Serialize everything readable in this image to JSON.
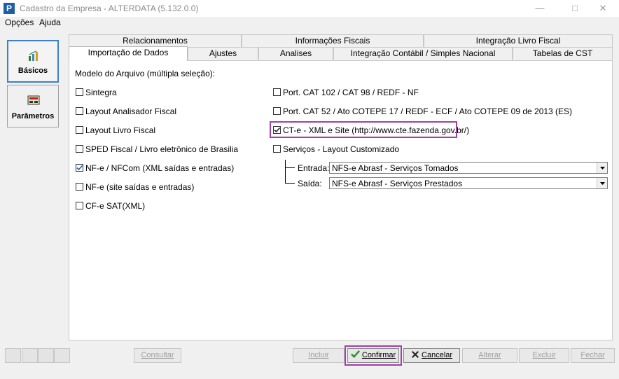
{
  "window": {
    "title": "Cadastro da Empresa - ALTERDATA (5.132.0.0)",
    "app_icon": "P"
  },
  "menu": [
    "Opções",
    "Ajuda"
  ],
  "sidebar": {
    "items": [
      {
        "label": "Básicos",
        "icon": "basicos-icon",
        "selected": true
      },
      {
        "label": "Parâmetros",
        "icon": "parametros-icon",
        "selected": false
      }
    ]
  },
  "tabs": {
    "row1": [
      "Relacionamentos",
      "Informações Fiscais",
      "Integração Livro Fiscal"
    ],
    "row2": [
      "Importação de Dados",
      "Ajustes",
      "Analises",
      "Integração Contábil / Simples Nacional",
      "Tabelas de CST"
    ],
    "active": "Importação de Dados"
  },
  "content": {
    "group_label": "Modelo do Arquivo (múltipla seleção):",
    "left_options": [
      {
        "label": "Sintegra",
        "checked": false
      },
      {
        "label": "Layout Analisador Fiscal",
        "checked": false
      },
      {
        "label": "Layout Livro Fiscal",
        "checked": false
      },
      {
        "label": "SPED Fiscal / Livro eletrônico de Brasilia",
        "checked": false
      },
      {
        "label": "NF-e / NFCom (XML saídas e entradas)",
        "checked": true
      },
      {
        "label": "NF-e (site saídas e entradas)",
        "checked": false
      },
      {
        "label": "CF-e SAT(XML)",
        "checked": false
      }
    ],
    "right_options": [
      {
        "label": "Port. CAT 102 / CAT 98 / REDF - NF",
        "checked": false
      },
      {
        "label": "Port. CAT 52 / Ato COTEPE 17 / REDF - ECF / Ato COTEPE 09 de 2013 (ES)",
        "checked": false
      },
      {
        "label": "CT-e - XML e Site (http://www.cte.fazenda.gov.br/)",
        "checked": true
      },
      {
        "label": "Serviços - Layout Customizado",
        "checked": false
      }
    ],
    "entrada": {
      "label": "Entrada:",
      "value": "NFS-e Abrasf - Serviços Tomados"
    },
    "saida": {
      "label": "Saída:",
      "value": "NFS-e Abrasf - Serviços Prestados"
    }
  },
  "buttons": {
    "consultar": "Consultar",
    "incluir": "Incluir",
    "confirmar": "Confirmar",
    "cancelar": "Cancelar",
    "alterar": "Alterar",
    "excluir": "Excluir",
    "fechar": "Fechar"
  },
  "colors": {
    "highlight_frame": "#a040a8",
    "selected_border": "#3c7fd0",
    "confirm_icon": "#2e8b2e",
    "cancel_icon": "#222222"
  }
}
